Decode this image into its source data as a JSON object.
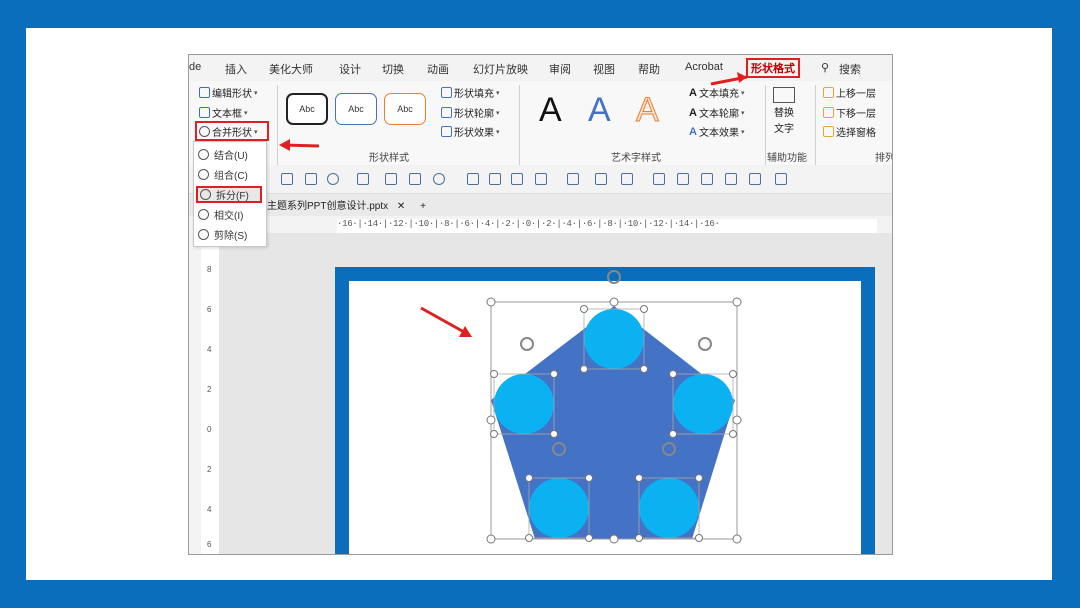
{
  "tabs": [
    "de",
    "插入",
    "美化大师",
    "设计",
    "切换",
    "动画",
    "幻灯片放映",
    "审阅",
    "视图",
    "帮助",
    "Acrobat",
    "形状格式",
    "搜索"
  ],
  "active_tab": "形状格式",
  "insert_group": {
    "edit_shape": "编辑形状",
    "text_box": "文本框",
    "merge_shapes": "合并形状"
  },
  "merge_menu": {
    "union": "结合(U)",
    "combine": "组合(C)",
    "fragment": "拆分(F)",
    "intersect": "相交(I)",
    "subtract": "剪除(S)"
  },
  "shape_styles": {
    "thumbs": [
      "Abc",
      "Abc",
      "Abc"
    ],
    "fill": "形状填充",
    "outline": "形状轮廓",
    "effects": "形状效果",
    "label": "形状样式"
  },
  "wordart": {
    "letters": [
      "A",
      "A",
      "A"
    ],
    "text_fill": "文本填充",
    "text_outline": "文本轮廓",
    "text_effects": "文本效果",
    "label": "艺术字样式"
  },
  "accessibility": {
    "alt_text": "替换\n文字",
    "alt_text_line1": "替换",
    "alt_text_line2": "文字",
    "label": "辅助功能"
  },
  "arrange": {
    "bring_forward": "上移一层",
    "send_backward": "下移一层",
    "selection_pane": "选择窗格",
    "label": "排列"
  },
  "document": {
    "filename": "主题系列PPT创意设计.pptx",
    "close": "✕",
    "new_tab": "+"
  },
  "ruler_text": "·16·|·14·|·12·|·10·|·8·|·6·|·4·|·2·|·0·|·2·|·4·|·6·|·8·|·10·|·12·|·14·|·16·",
  "ruler_v_labels": [
    "8",
    "6",
    "4",
    "2",
    "0",
    "2",
    "4",
    "6",
    "8"
  ],
  "colors": {
    "frame_blue": "#0a6ebd",
    "pentagon": "#4472c4",
    "circle": "#0bb1f0",
    "highlight_red": "#e02020"
  }
}
